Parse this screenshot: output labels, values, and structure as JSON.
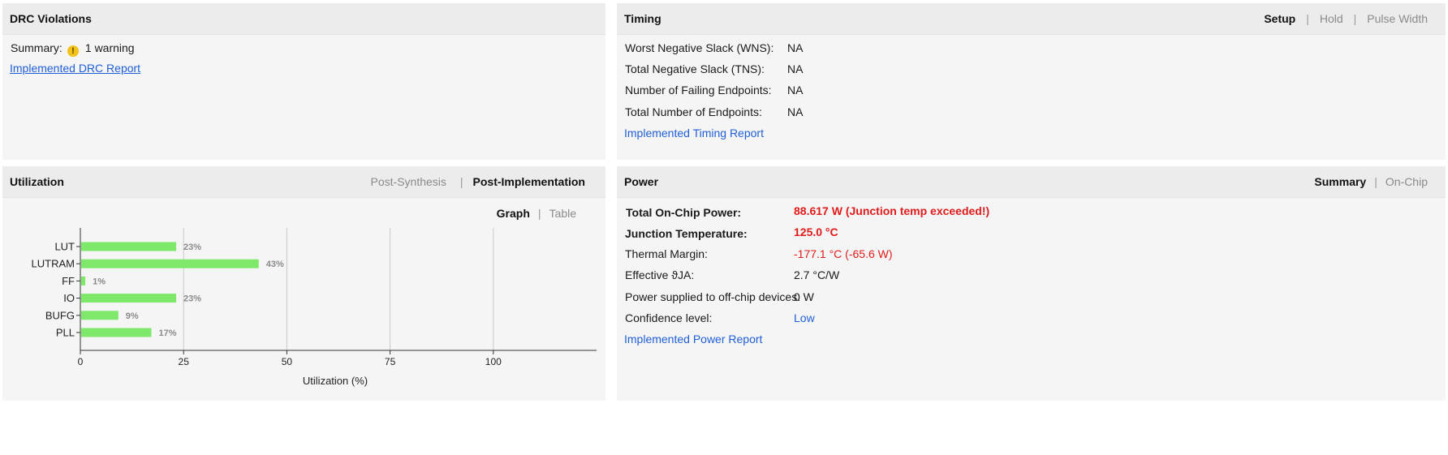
{
  "drc": {
    "title": "DRC Violations",
    "summary_label": "Summary:",
    "warning_text": "1 warning",
    "warning_icon": "warning-icon",
    "report_link": "Implemented DRC Report"
  },
  "timing": {
    "title": "Timing",
    "tabs": [
      {
        "label": "Setup",
        "active": true
      },
      {
        "label": "Hold",
        "active": false
      },
      {
        "label": "Pulse Width",
        "active": false
      }
    ],
    "rows": [
      {
        "label": "Worst Negative Slack (WNS):",
        "value": "NA"
      },
      {
        "label": "Total Negative Slack (TNS):",
        "value": "NA"
      },
      {
        "label": "Number of Failing Endpoints:",
        "value": "NA"
      },
      {
        "label": "Total Number of Endpoints:",
        "value": "NA"
      }
    ],
    "report_link": "Implemented Timing Report"
  },
  "utilization": {
    "title": "Utilization",
    "tabs": [
      {
        "label": "Post-Synthesis",
        "active": false
      },
      {
        "label": "Post-Implementation",
        "active": true
      }
    ],
    "view_tabs": [
      {
        "label": "Graph",
        "active": true
      },
      {
        "label": "Table",
        "active": false
      }
    ]
  },
  "power": {
    "title": "Power",
    "tabs": [
      {
        "label": "Summary",
        "active": true
      },
      {
        "label": "On-Chip",
        "active": false
      }
    ],
    "rows": [
      {
        "label": "Total On-Chip Power:",
        "value": "88.617 W (Junction temp exceeded!)"
      },
      {
        "label": "Junction Temperature:",
        "value": "125.0 °C"
      },
      {
        "label": "Thermal Margin:",
        "value": "-177.1 °C (-65.6 W)"
      },
      {
        "label": "Effective ϑJA:",
        "value": "2.7 °C/W"
      },
      {
        "label": "Power supplied to off-chip devices:",
        "value": "0 W"
      },
      {
        "label": "Confidence level:",
        "value": "Low"
      }
    ],
    "report_link": "Implemented Power Report"
  },
  "chart_data": {
    "type": "bar",
    "orientation": "horizontal",
    "categories": [
      "LUT",
      "LUTRAM",
      "FF",
      "IO",
      "BUFG",
      "PLL"
    ],
    "values": [
      23,
      43,
      1,
      23,
      9,
      17
    ],
    "data_labels": [
      "23%",
      "43%",
      "1%",
      "23%",
      "9%",
      "17%"
    ],
    "xlabel": "Utilization (%)",
    "ylabel": "",
    "xlim": [
      0,
      125
    ],
    "xticks": [
      0,
      25,
      50,
      75,
      100
    ],
    "grid": true,
    "bar_color": "#7ee86a"
  },
  "colors": {
    "link": "#1f5fd6",
    "error": "#e01b1b",
    "warning": "#f2c21b",
    "bar": "#7ee86a"
  }
}
